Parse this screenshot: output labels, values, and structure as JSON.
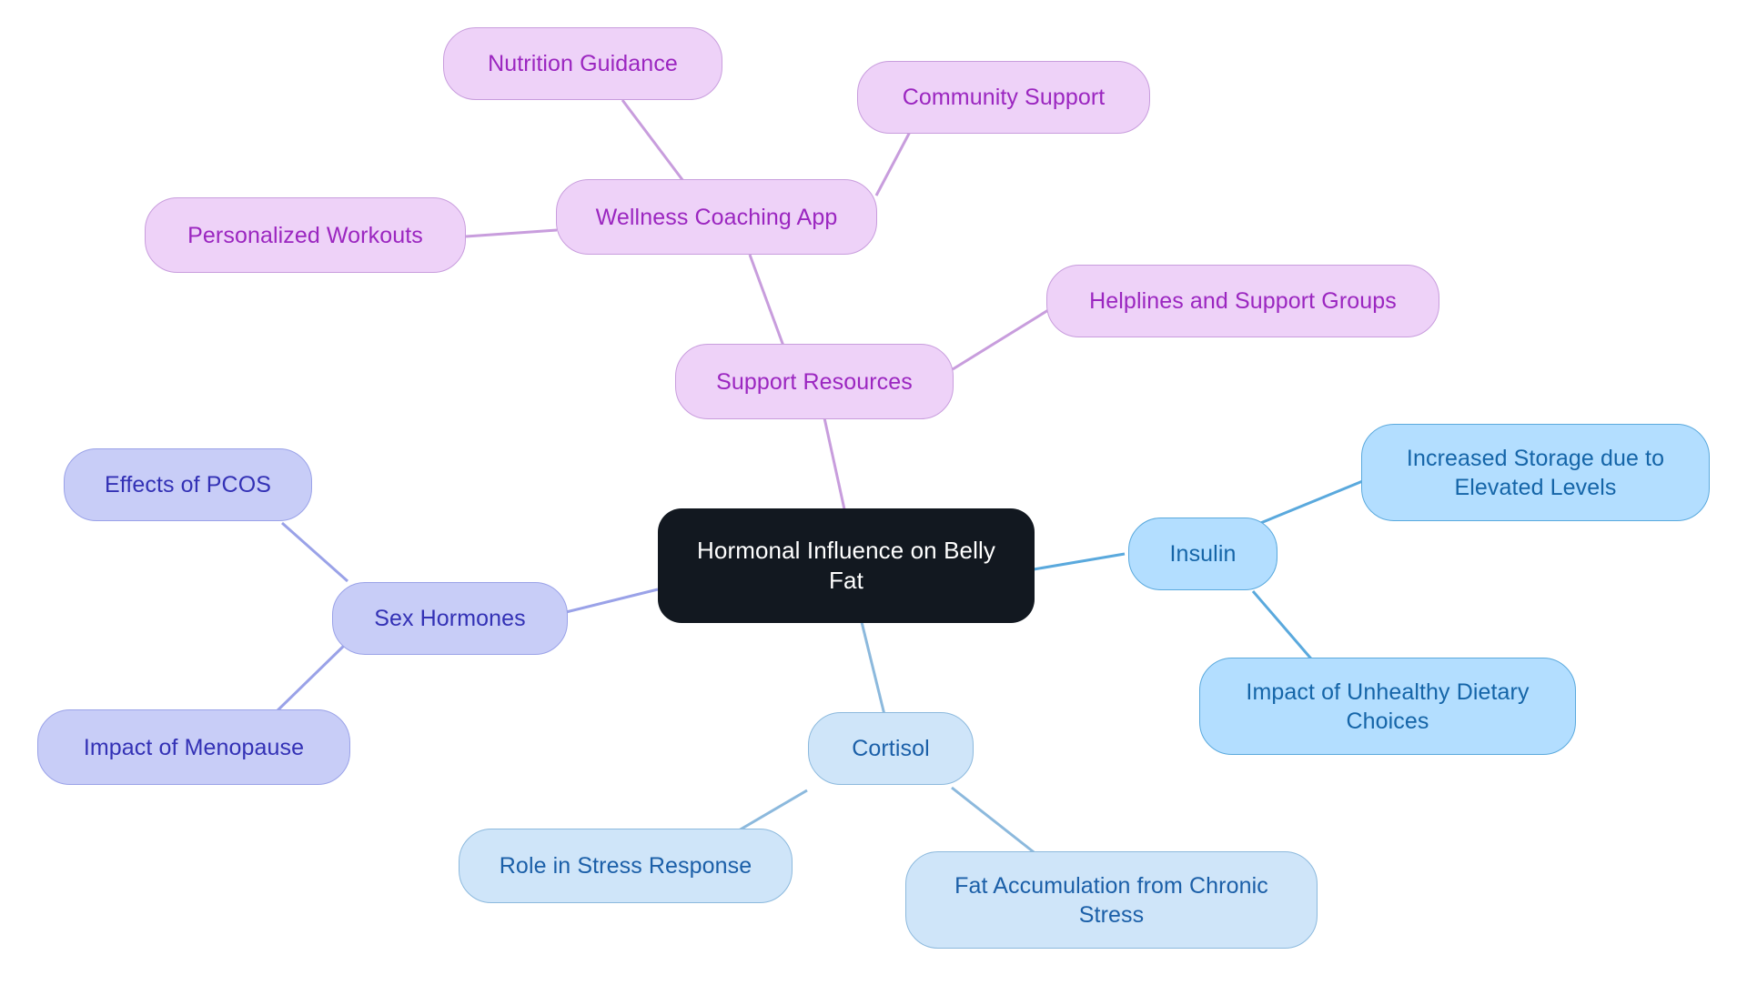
{
  "diagram": {
    "type": "mindmap",
    "title": "Hormonal Influence on Belly Fat",
    "background": "#ffffff",
    "palette": {
      "root_fill": "#121820",
      "root_text": "#ffffff",
      "insulin_fill": "#b3deff",
      "insulin_border": "#5aa9dd",
      "insulin_text": "#1565a8",
      "cortisol_fill": "#cfe5f9",
      "cortisol_border": "#8cb9dd",
      "cortisol_text": "#1b5fa8",
      "sex_fill": "#c8cdf7",
      "sex_border": "#9aa2e8",
      "sex_text": "#3331b5",
      "support_fill": "#eed2f8",
      "support_border": "#c89ddd",
      "support_text": "#9b26c0",
      "wellness_fill": "#eed2f8",
      "wellness_border": "#c89ddd",
      "wellness_text": "#9b26c0"
    }
  },
  "nodes": {
    "root": {
      "label": "Hormonal Influence on Belly\nFat"
    },
    "insulin": {
      "label": "Insulin"
    },
    "insulin_child_1": {
      "label": "Increased Storage due to\nElevated Levels"
    },
    "insulin_child_2": {
      "label": "Impact of Unhealthy Dietary\nChoices"
    },
    "cortisol": {
      "label": "Cortisol"
    },
    "cortisol_child_1": {
      "label": "Role in Stress Response"
    },
    "cortisol_child_2": {
      "label": "Fat Accumulation from Chronic\nStress"
    },
    "sex_hormones": {
      "label": "Sex Hormones"
    },
    "sex_child_1": {
      "label": "Effects of PCOS"
    },
    "sex_child_2": {
      "label": "Impact of Menopause"
    },
    "support_resources": {
      "label": "Support Resources"
    },
    "support_child_1": {
      "label": "Helplines and Support Groups"
    },
    "wellness_app": {
      "label": "Wellness Coaching App"
    },
    "wellness_child_1": {
      "label": "Nutrition Guidance"
    },
    "wellness_child_2": {
      "label": "Community Support"
    },
    "wellness_child_3": {
      "label": "Personalized Workouts"
    }
  },
  "branches": [
    {
      "name": "Insulin",
      "color": "#5aa9dd",
      "children": [
        "Increased Storage due to Elevated Levels",
        "Impact of Unhealthy Dietary Choices"
      ]
    },
    {
      "name": "Cortisol",
      "color": "#8cb9dd",
      "children": [
        "Role in Stress Response",
        "Fat Accumulation from Chronic Stress"
      ]
    },
    {
      "name": "Sex Hormones",
      "color": "#9aa2e8",
      "children": [
        "Effects of PCOS",
        "Impact of Menopause"
      ]
    },
    {
      "name": "Support Resources",
      "color": "#c89ddd",
      "children": [
        "Helplines and Support Groups",
        "Wellness Coaching App"
      ]
    },
    {
      "name": "Wellness Coaching App",
      "color": "#c89ddd",
      "children": [
        "Nutrition Guidance",
        "Community Support",
        "Personalized Workouts"
      ]
    }
  ]
}
